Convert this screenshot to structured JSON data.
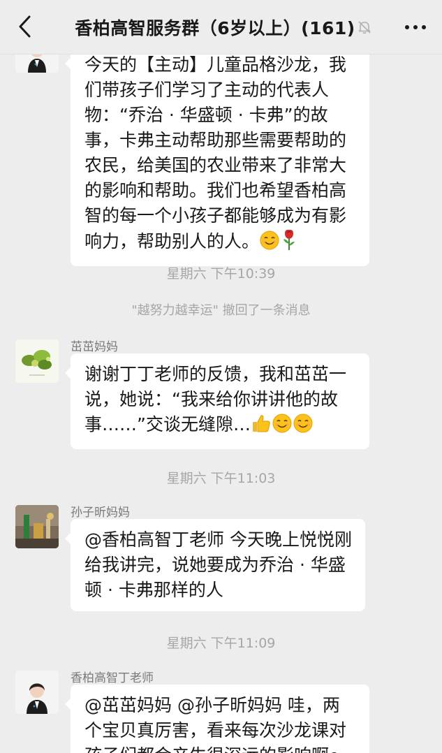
{
  "header": {
    "title": "香柏高智服务群（6岁以上）(161)",
    "back_icon": "chevron-left-icon",
    "mute_icon": "bell-off-icon",
    "more_icon": "more-icon"
  },
  "messages": [
    {
      "sender": "",
      "text": "今天的【主动】儿童品格沙龙，我们带孩子们学习了主动的代表人物：“乔治 · 华盛顿 · 卡弗”的故事，卡弗主动帮助那些需要帮助的农民，给美国的农业带来了非常大的影响和帮助。我们也希望香柏高智的每一个小孩子都能够成为有影响力，帮助别人的人。",
      "emojis": [
        "smile-emoji",
        "rose-emoji"
      ]
    },
    {
      "sender": "茁茁妈妈",
      "text": "谢谢丁丁老师的反馈，我和茁茁一说，她说：“我来给你讲讲他的故事……”交谈无缝隙…",
      "emojis": [
        "thumbs-up-emoji",
        "smile-emoji",
        "smile-emoji"
      ]
    },
    {
      "sender": "孙子昕妈妈",
      "text": "@香柏高智丁老师 今天晚上悦悦刚给我讲完，说她要成为乔治 · 华盛顿 · 卡弗那样的人"
    },
    {
      "sender": "香柏高智丁老师",
      "text": "@茁茁妈妈 @孙子昕妈妈 哇，两个宝贝真厉害，看来每次沙龙课对孩子们都会产生很深远的影响啊～"
    }
  ],
  "timestamps": [
    "星期六 下午10:39",
    "星期六 下午11:03",
    "星期六 下午11:09"
  ],
  "system_notice": "\"越努力越幸运\" 撤回了一条消息",
  "colors": {
    "background": "#ededed",
    "bubble": "#ffffff",
    "text": "#191919",
    "meta": "#a6a6a6"
  }
}
